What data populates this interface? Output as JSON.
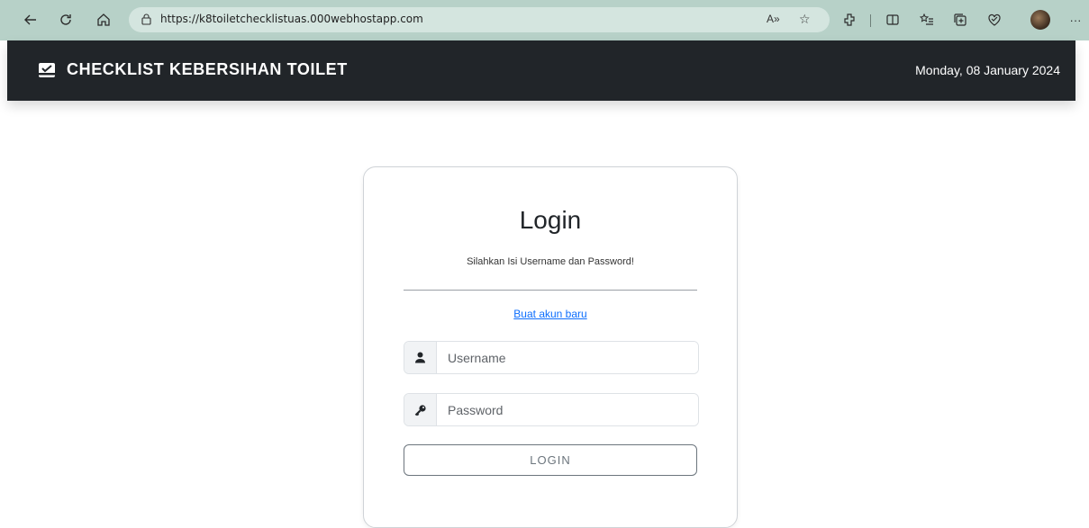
{
  "browser": {
    "url": "https://k8toiletchecklistuas.000webhostapp.com",
    "read_aloud": "A»",
    "more": "···"
  },
  "header": {
    "brand_icon": "inbox-check-icon",
    "title": "CHECKLIST KEBERSIHAN TOILET",
    "date": "Monday, 08 January 2024",
    "background": "#212529"
  },
  "login": {
    "title": "Login",
    "subtitle": "Silahkan Isi Username dan Password!",
    "register_link": "Buat akun baru",
    "username_placeholder": "Username",
    "password_placeholder": "Password",
    "button_label": "LOGIN",
    "link_color": "#0d6efd"
  }
}
